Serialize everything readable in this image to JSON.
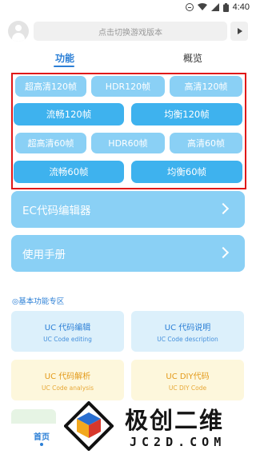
{
  "status_bar": {
    "time": "4:40"
  },
  "header": {
    "search_placeholder": "点击切换游戏版本"
  },
  "tabs": [
    {
      "label": "功能"
    },
    {
      "label": "概览"
    }
  ],
  "fps_buttons": [
    {
      "label": "超高清120帧"
    },
    {
      "label": "HDR120帧"
    },
    {
      "label": "高清120帧"
    },
    {
      "label": "流畅120帧"
    },
    {
      "label": "均衡120帧"
    },
    {
      "label": "超高清60帧"
    },
    {
      "label": "HDR60帧"
    },
    {
      "label": "高清60帧"
    },
    {
      "label": "流畅60帧"
    },
    {
      "label": "均衡60帧"
    }
  ],
  "menu_cards": [
    {
      "label": "EC代码编辑器"
    },
    {
      "label": "使用手册"
    }
  ],
  "section": {
    "title": "◎基本功能专区"
  },
  "features": [
    {
      "title": "UC 代码编辑",
      "subtitle": "UC Code editing",
      "theme": "#2b7fd6"
    },
    {
      "title": "UC 代码说明",
      "subtitle": "UC Code description",
      "theme": "#2b7fd6"
    },
    {
      "title": "UC 代码解析",
      "subtitle": "UC Code analysis",
      "theme": "#e39a1a"
    },
    {
      "title": "UC DIY代码",
      "subtitle": "UC DIY Code",
      "theme": "#e39a1a"
    }
  ],
  "bottom_nav": {
    "home_label": "首页"
  },
  "watermark": {
    "main": "极创二维",
    "sub": "JC2D.COM"
  },
  "colors": {
    "accent": "#2b7fd6",
    "button_light": "#8ad0f5",
    "button_mid": "#3eb2ee",
    "highlight_border": "#e01818"
  }
}
